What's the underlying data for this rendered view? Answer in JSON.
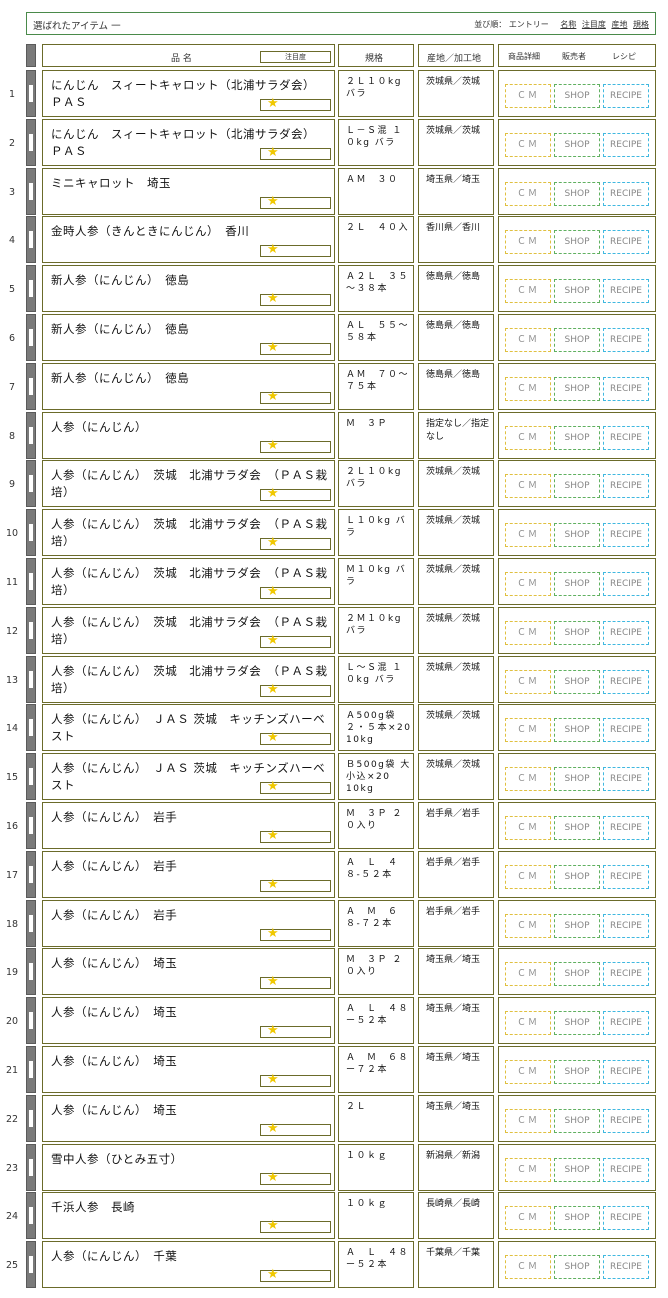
{
  "header": {
    "title": "選ばれたアイテム 一",
    "sort_label": "並び順：",
    "sort_entry": "エントリー",
    "sort_options": [
      "名称",
      "注目度",
      "産地",
      "規格"
    ]
  },
  "columns": {
    "name": "品 名",
    "attention": "注目度",
    "spec": "規格",
    "origin": "産地／加工地",
    "details": "商品詳細",
    "seller": "販売者",
    "recipe": "レシピ"
  },
  "buttons": {
    "cm": "ＣＭ",
    "shop": "SHOP",
    "recipe": "RECIPE"
  },
  "star_icon": "star-icon",
  "colors": {
    "star": "#f0c800",
    "cm_border": "#e0c040",
    "shop_border": "#60b060",
    "recipe_border": "#40b8e0",
    "frame": "#6b6b2a"
  },
  "items": [
    {
      "num": "1",
      "name": "にんじん　スィートキャロット（北浦サラダ会）　ＰＡＳ",
      "spec": "２Ｌ１０kg バラ",
      "origin": "茨城県／茨城"
    },
    {
      "num": "2",
      "name": "にんじん　スィートキャロット（北浦サラダ会）　ＰＡＳ",
      "spec": "Ｌ－Ｓ混 １０kg バラ",
      "origin": "茨城県／茨城"
    },
    {
      "num": "3",
      "name": "ミニキャロット　埼玉",
      "spec": "ＡＭ　３０",
      "origin": "埼玉県／埼玉"
    },
    {
      "num": "4",
      "name": "金時人参（きんときにんじん）　香川",
      "spec": "２Ｌ　４０入",
      "origin": "香川県／香川"
    },
    {
      "num": "5",
      "name": "新人参（にんじん）　徳島",
      "spec": "Ａ２Ｌ　３５～３８本",
      "origin": "徳島県／徳島"
    },
    {
      "num": "6",
      "name": "新人参（にんじん）　徳島",
      "spec": "ＡＬ　５５～５８本",
      "origin": "徳島県／徳島"
    },
    {
      "num": "7",
      "name": "新人参（にんじん）　徳島",
      "spec": "ＡＭ　７０～７５本",
      "origin": "徳島県／徳島"
    },
    {
      "num": "8",
      "name": "人参（にんじん）",
      "spec": "Ｍ　３Ｐ",
      "origin": "指定なし／指定なし"
    },
    {
      "num": "9",
      "name": "人参（にんじん）　茨城　北浦サラダ会　（ＰＡＳ栽培）",
      "spec": "２Ｌ１０kg バラ",
      "origin": "茨城県／茨城"
    },
    {
      "num": "10",
      "name": "人参（にんじん）　茨城　北浦サラダ会　（ＰＡＳ栽培）",
      "spec": "Ｌ１０kg バラ",
      "origin": "茨城県／茨城"
    },
    {
      "num": "11",
      "name": "人参（にんじん）　茨城　北浦サラダ会　（ＰＡＳ栽培）",
      "spec": "Ｍ１０kg バラ",
      "origin": "茨城県／茨城"
    },
    {
      "num": "12",
      "name": "人参（にんじん）　茨城　北浦サラダ会　（ＰＡＳ栽培）",
      "spec": "２Ｍ１０kg バラ",
      "origin": "茨城県／茨城"
    },
    {
      "num": "13",
      "name": "人参（にんじん）　茨城　北浦サラダ会　（ＰＡＳ栽培）",
      "spec": "Ｌ～Ｓ混 １０kg バラ",
      "origin": "茨城県／茨城"
    },
    {
      "num": "14",
      "name": "人参（にんじん）　ＪＡＳ 茨城　キッチンズハーベスト",
      "spec": "Ａ500g袋２・５本×20 10kg",
      "origin": "茨城県／茨城"
    },
    {
      "num": "15",
      "name": "人参（にんじん）　ＪＡＳ 茨城　キッチンズハーベスト",
      "spec": "Ｂ500g袋 大小込×20 10kg",
      "origin": "茨城県／茨城"
    },
    {
      "num": "16",
      "name": "人参（にんじん）　岩手",
      "spec": "Ｍ　３Ｐ ２０入り",
      "origin": "岩手県／岩手"
    },
    {
      "num": "17",
      "name": "人参（にんじん）　岩手",
      "spec": "Ａ　Ｌ　４８-５２本",
      "origin": "岩手県／岩手"
    },
    {
      "num": "18",
      "name": "人参（にんじん）　岩手",
      "spec": "Ａ　Ｍ　６８-７２本",
      "origin": "岩手県／岩手"
    },
    {
      "num": "19",
      "name": "人参（にんじん）　埼玉",
      "spec": "Ｍ　３Ｐ ２０入り",
      "origin": "埼玉県／埼玉"
    },
    {
      "num": "20",
      "name": "人参（にんじん）　埼玉",
      "spec": "Ａ　Ｌ　４８ー５２本",
      "origin": "埼玉県／埼玉"
    },
    {
      "num": "21",
      "name": "人参（にんじん）　埼玉",
      "spec": "Ａ　Ｍ　６８ー７２本",
      "origin": "埼玉県／埼玉"
    },
    {
      "num": "22",
      "name": "人参（にんじん）　埼玉",
      "spec": "２Ｌ",
      "origin": "埼玉県／埼玉"
    },
    {
      "num": "23",
      "name": "雪中人参（ひとみ五寸）",
      "spec": "１０ｋｇ",
      "origin": "新潟県／新潟"
    },
    {
      "num": "24",
      "name": "千浜人参　長崎",
      "spec": "１０ｋｇ",
      "origin": "長崎県／長崎"
    },
    {
      "num": "25",
      "name": "人参（にんじん）　千葉",
      "spec": "Ａ　Ｌ　４８ー５２本",
      "origin": "千葉県／千葉"
    }
  ]
}
